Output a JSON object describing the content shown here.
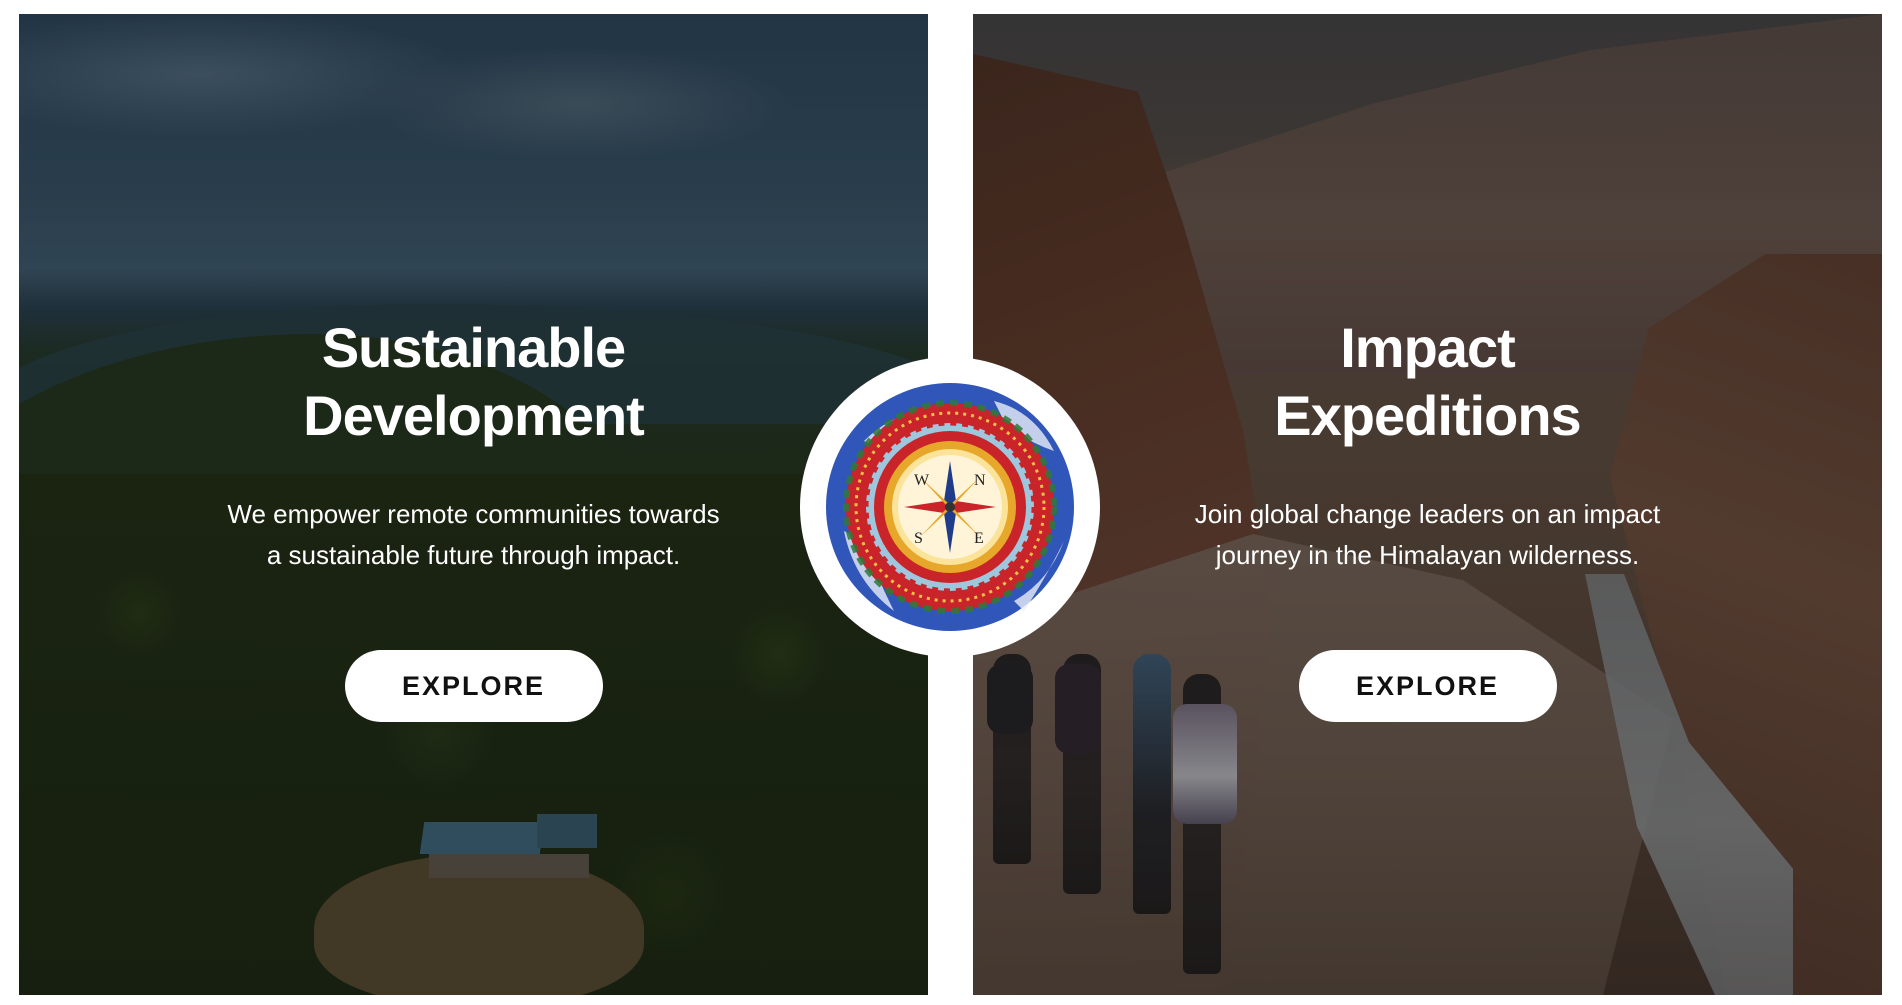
{
  "cards": [
    {
      "title_line1": "Sustainable",
      "title_line2": "Development",
      "description": "We empower remote communities towards a sustainable future through impact.",
      "button_label": "EXPLORE"
    },
    {
      "title_line1": "Impact",
      "title_line2": "Expeditions",
      "description": "Join global change leaders on an impact journey in the Himalayan wilderness.",
      "button_label": "EXPLORE"
    }
  ],
  "logo": {
    "compass_points": [
      "N",
      "E",
      "S",
      "W"
    ],
    "colors": {
      "outer_ring": "#2f56b8",
      "red_band": "#c8242a",
      "gold_ring": "#e7a72b",
      "inner_face": "#fff4d8"
    }
  },
  "colors": {
    "overlay": "rgba(0,0,0,0.35)",
    "button_bg": "#ffffff",
    "button_text": "#111111",
    "text": "#ffffff"
  }
}
